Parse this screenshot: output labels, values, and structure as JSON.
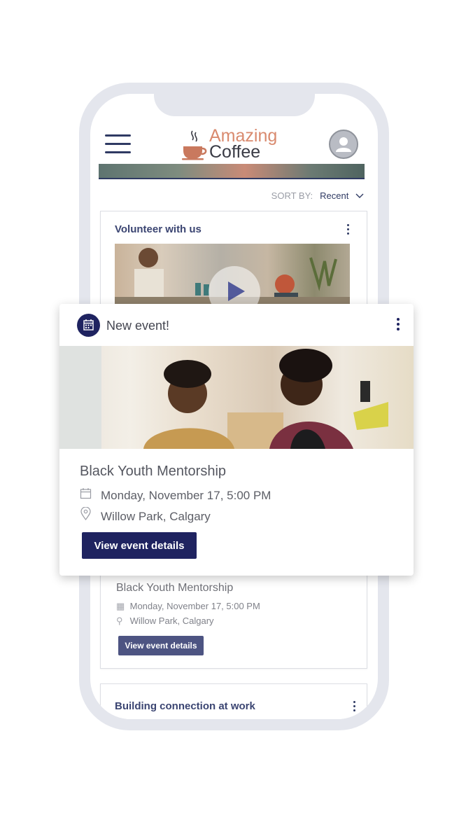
{
  "header": {
    "logo_line1": "Amazing",
    "logo_line2": "Coffee"
  },
  "sort": {
    "label": "SORT BY:",
    "value": "Recent"
  },
  "feed": {
    "card1_title": "Volunteer with us",
    "bg_event": {
      "title": "Black Youth Mentorship",
      "date": "Monday, November 17, 5:00 PM",
      "location": "Willow Park, Calgary",
      "button": "View event details"
    },
    "card3_title": "Building connection at work"
  },
  "popup": {
    "label": "New event!",
    "title": "Black Youth Mentorship",
    "date": "Monday, November 17, 5:00 PM",
    "location": "Willow Park, Calgary",
    "button": "View event details"
  },
  "colors": {
    "brand_navy": "#1f2360",
    "logo_accent": "#d98a6e",
    "phone_frame": "#e4e6ed"
  },
  "icons": [
    "menu-icon",
    "coffee-cup-icon",
    "user-avatar-icon",
    "chevron-down-icon",
    "kebab-menu-icon",
    "play-icon",
    "calendar-icon",
    "location-pin-icon"
  ]
}
